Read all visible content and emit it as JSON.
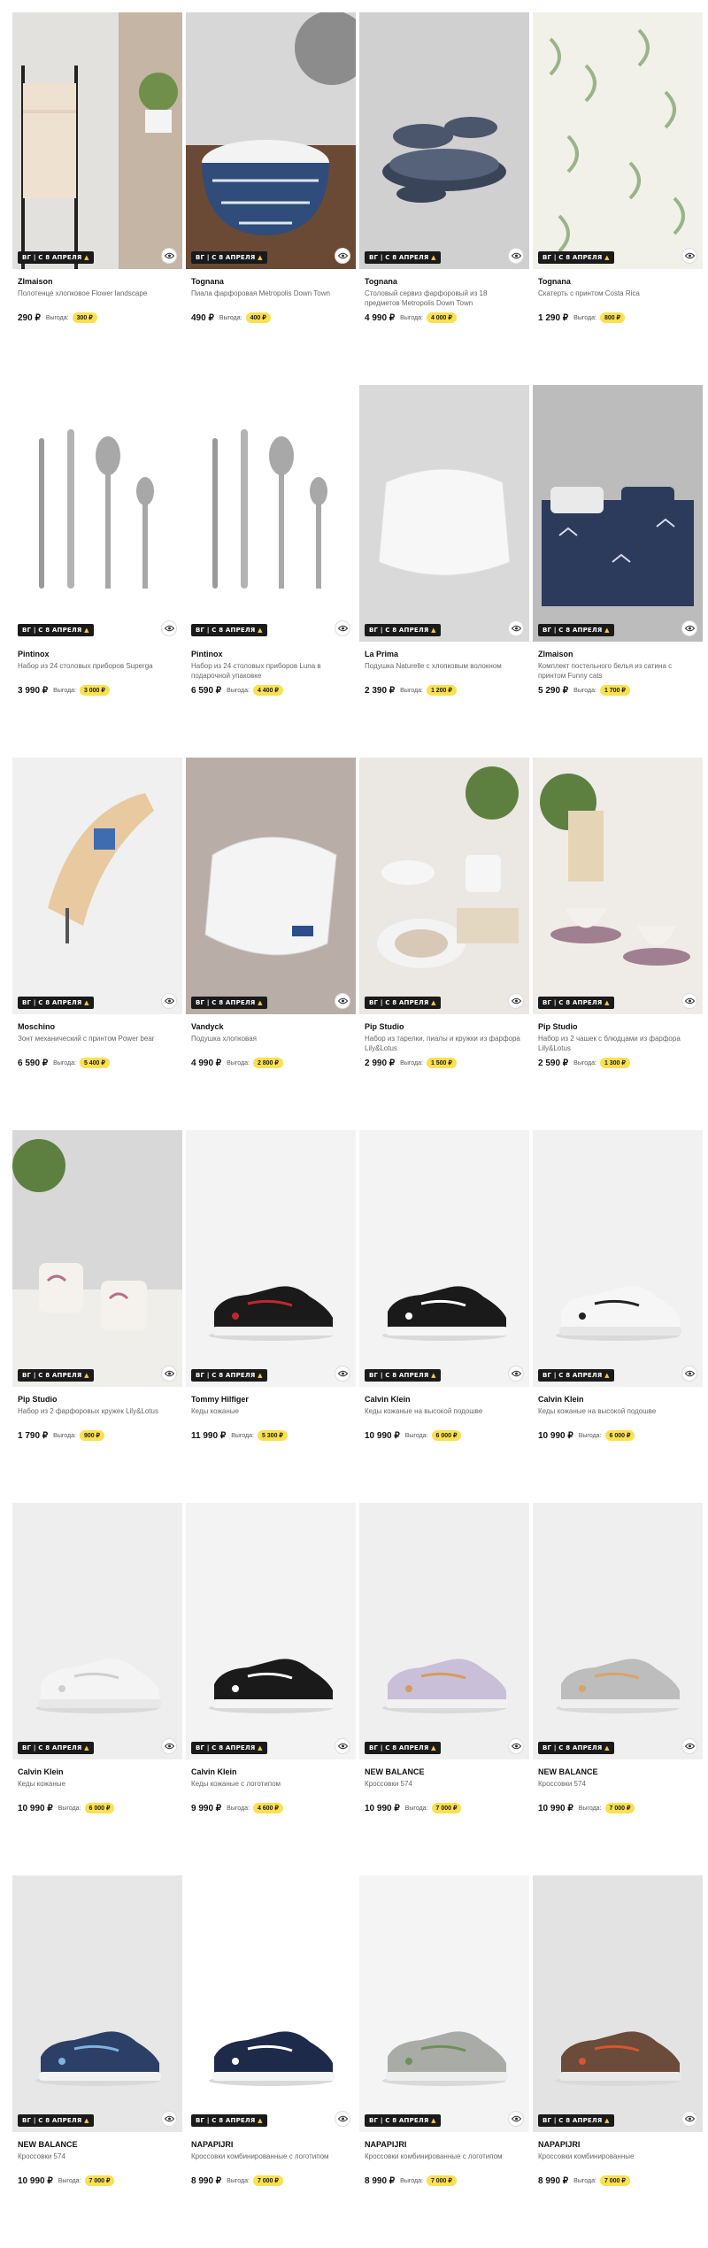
{
  "badge": {
    "text": "ВГ | С 8 АПРЕЛЯ",
    "icon": "flame-icon"
  },
  "benefit_label": "Выгода:",
  "colors": {
    "badge_bg": "#1a1a1a",
    "benefit_bg": "#fbe04f"
  },
  "products": [
    {
      "brand": "Zlmaison",
      "name": "Полотенце хлопковое Flower landscape",
      "price": "290 ₽",
      "benefit": "300 ₽",
      "image": "towel-on-rack"
    },
    {
      "brand": "Tognana",
      "name": "Пиала фарфоровая Metropolis Down Town",
      "price": "490 ₽",
      "benefit": "400 ₽",
      "image": "patterned-bowl"
    },
    {
      "brand": "Tognana",
      "name": "Столовый сервиз фарфоровый из 18 предметов Metropolis Down Town",
      "price": "4 990 ₽",
      "benefit": "4 000 ₽",
      "image": "plate-stack"
    },
    {
      "brand": "Tognana",
      "name": "Скатерть с принтом Costa Rica",
      "price": "1 290 ₽",
      "benefit": "800 ₽",
      "image": "leaf-tablecloth"
    },
    {
      "brand": "Pintinox",
      "name": "Набор из 24 столовых приборов Superga",
      "price": "3 990 ₽",
      "benefit": "3 000 ₽",
      "image": "cutlery-set"
    },
    {
      "brand": "Pintinox",
      "name": "Набор из 24 столовых приборов Luna в подарочной упаковке",
      "price": "6 590 ₽",
      "benefit": "4 400 ₽",
      "image": "cutlery-set"
    },
    {
      "brand": "La Prima",
      "name": "Подушка Naturelle с хлопковым волокном",
      "price": "2 390 ₽",
      "benefit": "1 200 ₽",
      "image": "white-pillow"
    },
    {
      "brand": "Zlmaison",
      "name": "Комплект постельного белья из сатина с принтом Funny cats",
      "price": "5 290 ₽",
      "benefit": "1 700 ₽",
      "image": "navy-bedding"
    },
    {
      "brand": "Moschino",
      "name": "Зонт механический с принтом Power bear",
      "price": "6 590 ₽",
      "benefit": "5 400 ₽",
      "image": "beige-umbrella"
    },
    {
      "brand": "Vandyck",
      "name": "Подушка хлопковая",
      "price": "4 990 ₽",
      "benefit": "2 800 ₽",
      "image": "white-pillow-dark"
    },
    {
      "brand": "Pip Studio",
      "name": "Набор из тарелки, пиалы и кружки из фарфора Lily&Lotus",
      "price": "2 990 ₽",
      "benefit": "1 500 ₽",
      "image": "tableware-set"
    },
    {
      "brand": "Pip Studio",
      "name": "Набор из 2 чашек с блюдцами из фарфора Lily&Lotus",
      "price": "2 590 ₽",
      "benefit": "1 300 ₽",
      "image": "cups-saucers"
    },
    {
      "brand": "Pip Studio",
      "name": "Набор из 2 фарфоровых кружек Lily&Lotus",
      "price": "1 790 ₽",
      "benefit": "900 ₽",
      "image": "two-mugs"
    },
    {
      "brand": "Tommy Hilfiger",
      "name": "Кеды кожаные",
      "price": "11 990 ₽",
      "benefit": "5 300 ₽",
      "image": "sneaker-black"
    },
    {
      "brand": "Calvin Klein",
      "name": "Кеды кожаные на высокой подошве",
      "price": "10 990 ₽",
      "benefit": "6 000 ₽",
      "image": "sneaker-black-ck"
    },
    {
      "brand": "Calvin Klein",
      "name": "Кеды кожаные на высокой подошве",
      "price": "10 990 ₽",
      "benefit": "6 000 ₽",
      "image": "sneaker-white-ck"
    },
    {
      "brand": "Calvin Klein",
      "name": "Кеды кожаные",
      "price": "10 990 ₽",
      "benefit": "6 000 ₽",
      "image": "sneaker-white"
    },
    {
      "brand": "Calvin Klein",
      "name": "Кеды кожаные с логотипом",
      "price": "9 990 ₽",
      "benefit": "4 600 ₽",
      "image": "sneaker-black-ck"
    },
    {
      "brand": "NEW BALANCE",
      "name": "Кроссовки 574",
      "price": "10 990 ₽",
      "benefit": "7 000 ₽",
      "image": "runner-lilac"
    },
    {
      "brand": "NEW BALANCE",
      "name": "Кроссовки 574",
      "price": "10 990 ₽",
      "benefit": "7 000 ₽",
      "image": "runner-grey"
    },
    {
      "brand": "NEW BALANCE",
      "name": "Кроссовки 574",
      "price": "10 990 ₽",
      "benefit": "7 000 ₽",
      "image": "runner-navy"
    },
    {
      "brand": "NAPAPIJRI",
      "name": "Кроссовки комбинированные с логотипом",
      "price": "8 990 ₽",
      "benefit": "7 000 ₽",
      "image": "runner-navy-dark"
    },
    {
      "brand": "NAPAPIJRI",
      "name": "Кроссовки комбинированные с логотипом",
      "price": "8 990 ₽",
      "benefit": "7 000 ₽",
      "image": "runner-grey-light"
    },
    {
      "brand": "NAPAPIJRI",
      "name": "Кроссовки комбинированные",
      "price": "8 990 ₽",
      "benefit": "7 000 ₽",
      "image": "runner-brown"
    }
  ]
}
